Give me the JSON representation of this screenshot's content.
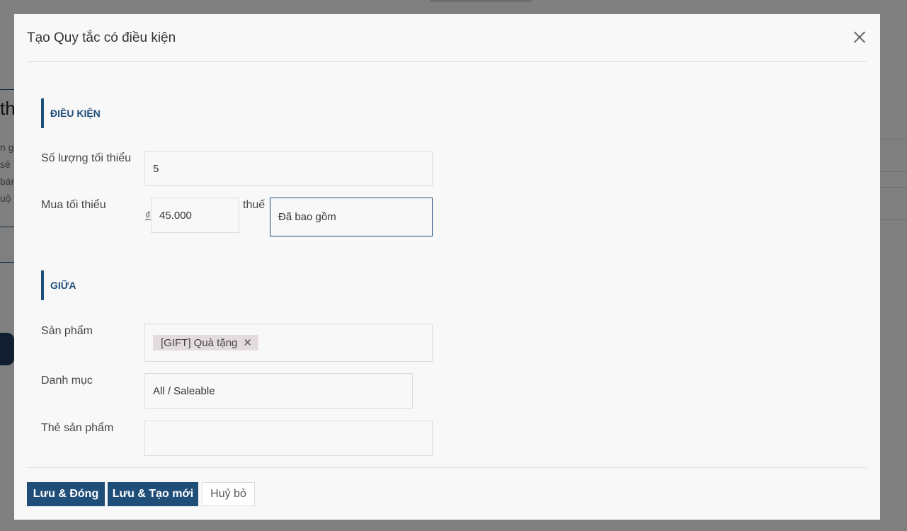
{
  "background": {
    "title_fragment": "th",
    "line_fragments": [
      "n g",
      "sê",
      "bán",
      "uộ"
    ]
  },
  "modal": {
    "title": "Tạo Quy tắc có điều kiện",
    "sections": {
      "conditions": "ĐIỀU KIỆN",
      "between": "GIỮA"
    },
    "fields": {
      "min_quantity": {
        "label": "Số lượng tối thiểu",
        "value": "5"
      },
      "min_purchase": {
        "label": "Mua tối thiểu",
        "currency": "₫",
        "value": "45.000",
        "tax_label": "thuế",
        "tax_value": "Đã bao gồm"
      },
      "products": {
        "label": "Sản phẩm",
        "tags": [
          "[GIFT] Quà tặng"
        ]
      },
      "category": {
        "label": "Danh mục",
        "value": "All / Saleable"
      },
      "product_tags": {
        "label": "Thẻ sản phẩm",
        "value": ""
      }
    },
    "footer": {
      "save_close": "Lưu & Đóng",
      "save_new": "Lưu & Tạo mới",
      "cancel": "Huỷ bỏ"
    }
  },
  "colors": {
    "accent": "#1f4e79",
    "tag_bg": "#e4dcdc",
    "overlay": "#8a8a8a"
  }
}
